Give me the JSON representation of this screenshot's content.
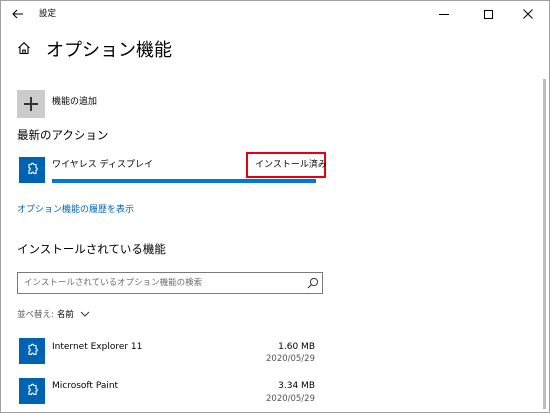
{
  "window": {
    "title": "設定",
    "back_icon": "back-arrow-icon",
    "minimize_icon": "minimize-icon",
    "maximize_icon": "maximize-icon",
    "close_icon": "close-icon"
  },
  "header": {
    "title": "オプション機能",
    "icon": "home-icon"
  },
  "add_feature": {
    "label": "機能の追加",
    "icon": "plus-icon"
  },
  "latest_actions": {
    "heading": "最新のアクション",
    "item": {
      "name": "ワイヤレス ディスプレイ",
      "status": "インストール済み",
      "progress_fraction": 1.0,
      "icon": "puzzle-icon"
    },
    "history_link": "オプション機能の履歴を表示"
  },
  "installed": {
    "heading": "インストールされている機能",
    "search_placeholder": "インストールされているオプション機能の検索",
    "sort_label": "並べ替え:",
    "sort_value": "名前",
    "items": [
      {
        "name": "Internet Explorer 11",
        "size": "1.60 MB",
        "date": "2020/05/29",
        "icon": "puzzle-icon"
      },
      {
        "name": "Microsoft Paint",
        "size": "3.34 MB",
        "date": "2020/05/29",
        "icon": "puzzle-icon"
      }
    ]
  },
  "colors": {
    "accent": "#0078d7",
    "tile": "#0063b1",
    "link": "#0063b1",
    "highlight_box": "#e60012"
  }
}
